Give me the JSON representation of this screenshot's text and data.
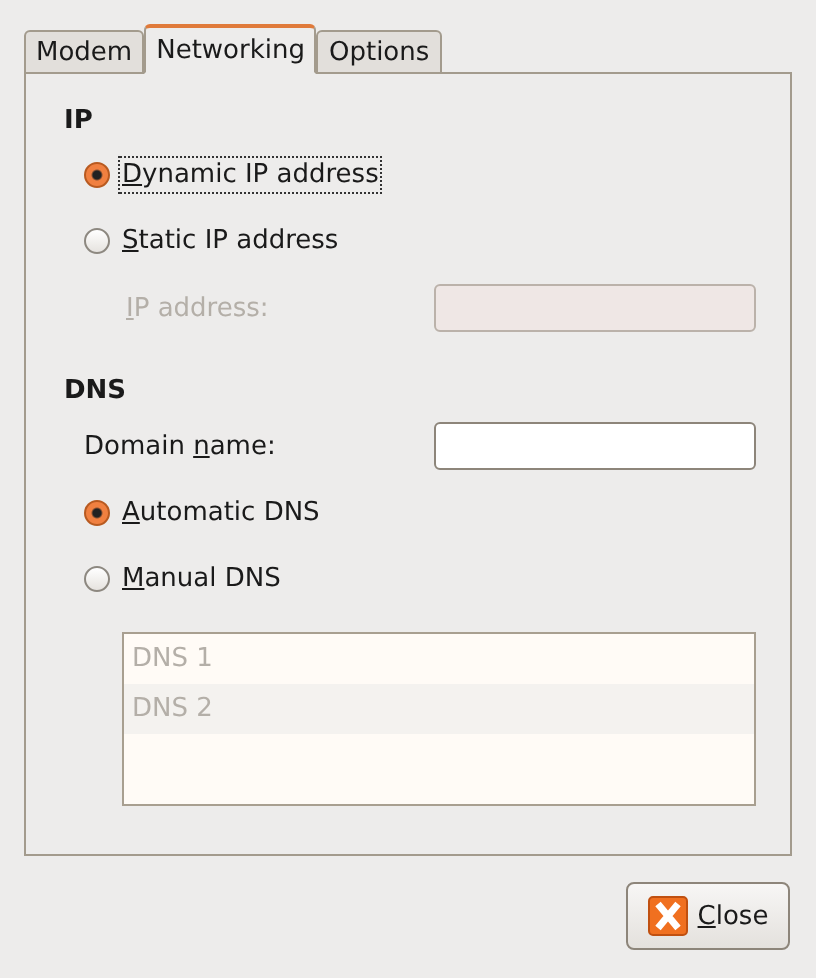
{
  "tabs": [
    {
      "label": "Modem",
      "selected": false
    },
    {
      "label": "Networking",
      "selected": true
    },
    {
      "label": "Options",
      "selected": false
    }
  ],
  "ip": {
    "heading": "IP",
    "options": [
      {
        "label": {
          "key": "D",
          "after": "ynamic IP address"
        },
        "selected": true,
        "focused": true
      },
      {
        "label": {
          "key": "S",
          "after": "tatic IP address"
        },
        "selected": false,
        "focused": false
      }
    ],
    "address": {
      "label": {
        "key": "I",
        "after": "P address:"
      },
      "disabled": true
    }
  },
  "dns": {
    "heading": "DNS",
    "domain": {
      "label": {
        "before": "Domain ",
        "key": "n",
        "after": "ame:"
      },
      "disabled": false
    },
    "options": [
      {
        "label": {
          "key": "A",
          "after": "utomatic DNS"
        },
        "selected": true,
        "focused": false
      },
      {
        "label": {
          "key": "M",
          "after": "anual DNS"
        },
        "selected": false,
        "focused": false
      }
    ],
    "servers": {
      "disabled": true,
      "rows": [
        "DNS 1",
        "DNS 2"
      ]
    }
  },
  "buttons": [
    {
      "label": {
        "key": "C",
        "after": "lose"
      }
    }
  ]
}
